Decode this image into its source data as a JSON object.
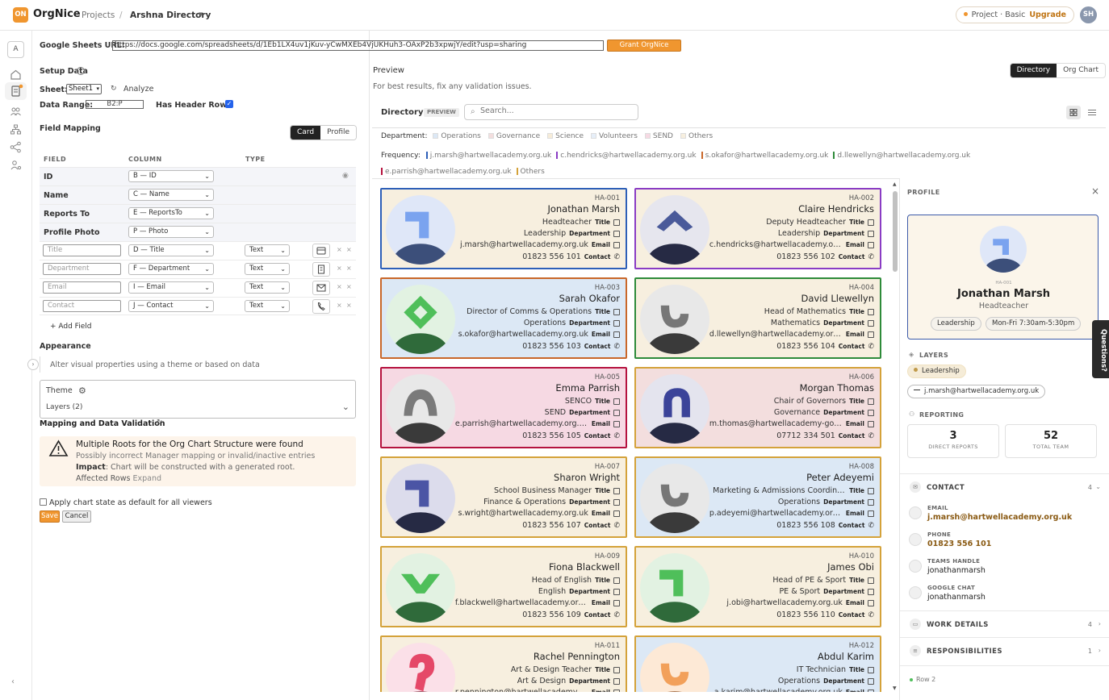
{
  "topbar": {
    "logo": "ON",
    "app_name": "OrgNice",
    "crumb_projects": "Projects",
    "crumb_sep": "/",
    "crumb_current": "Arshna Directory",
    "plan_label": "Project · Basic",
    "upgrade_label": "Upgrade",
    "user_initials": "SH"
  },
  "rail": {
    "workspace_initial": "A"
  },
  "setup": {
    "url_label": "Google Sheets URL:",
    "url_value": "https://docs.google.com/spreadsheets/d/1Eb1LX4uv1jKuv-yCwMXEb4VjUKHuh3-OAxP2b3xpwjY/edit?usp=sharing",
    "grant_label": "Grant OrgNice Access",
    "setup_title": "Setup Data",
    "sheet_label": "Sheet:",
    "sheet_value": "Sheet1",
    "analyze_label": "Analyze",
    "range_label": "Data Range:",
    "range_value": "B2:P",
    "header_row_label": "Has Header Row",
    "field_mapping_title": "Field Mapping",
    "card_tab": "Card",
    "profile_tab": "Profile",
    "col_field": "FIELD",
    "col_column": "COLUMN",
    "col_type": "TYPE",
    "required_fields": [
      {
        "name": "ID",
        "column": "B — ID"
      },
      {
        "name": "Name",
        "column": "C — Name"
      },
      {
        "name": "Reports To",
        "column": "E — ReportsTo"
      },
      {
        "name": "Profile Photo",
        "column": "P — Photo"
      }
    ],
    "custom_fields": [
      {
        "name": "Title",
        "column": "D — Title",
        "type": "Text",
        "icon": "id-card-icon"
      },
      {
        "name": "Department",
        "column": "F — Department",
        "type": "Text",
        "icon": "building-icon"
      },
      {
        "name": "Email",
        "column": "I — Email",
        "type": "Text",
        "icon": "envelope-icon"
      },
      {
        "name": "Contact",
        "column": "J — Contact",
        "type": "Text",
        "icon": "phone-icon"
      }
    ],
    "add_field": "+ Add Field",
    "appearance_title": "Appearance",
    "appearance_hint": "Alter visual properties using a theme or based on data",
    "theme_label": "Theme",
    "layers_label": "Layers (2)",
    "validation_title": "Mapping and Data Validation",
    "warn_title": "Multiple Roots for the Org Chart Structure were found",
    "warn_line1": "Possibly incorrect Manager mapping or invalid/inactive entries",
    "warn_impact_key": "Impact",
    "warn_impact": ": Chart will be constructed with a generated root.",
    "warn_rows": "Affected Rows",
    "warn_expand": "Expand",
    "default_state_label": "Apply chart state as default for all viewers",
    "save_label": "Save",
    "cancel_label": "Cancel"
  },
  "preview": {
    "title": "Preview",
    "hint": "For best results, fix any validation issues.",
    "view_directory": "Directory",
    "view_orgchart": "Org Chart",
    "dir_title": "Directory",
    "dir_badge": "PREVIEW",
    "search_placeholder": "Search...",
    "dept_label": "Department:",
    "departments": [
      {
        "name": "Operations",
        "color": "#dce8f5"
      },
      {
        "name": "Governance",
        "color": "#f3dede"
      },
      {
        "name": "Science",
        "color": "#f6ecd9"
      },
      {
        "name": "Volunteers",
        "color": "#e6eef8"
      },
      {
        "name": "SEND",
        "color": "#f6d9e3"
      },
      {
        "name": "Others",
        "color": "#f7efdf"
      }
    ],
    "freq_label": "Frequency:",
    "frequency": [
      {
        "name": "j.marsh@hartwellacademy.org.uk",
        "color": "#2d5fb8"
      },
      {
        "name": "c.hendricks@hartwellacademy.org.uk",
        "color": "#8a3cc4"
      },
      {
        "name": "s.okafor@hartwellacademy.org.uk",
        "color": "#c9672a"
      },
      {
        "name": "d.llewellyn@hartwellacademy.org.uk",
        "color": "#2e8b3a"
      },
      {
        "name": "e.parrish@hartwellacademy.org.uk",
        "color": "#b5123e"
      },
      {
        "name": "Others",
        "color": "#d4a23a"
      }
    ],
    "field_keys": {
      "title": "Title",
      "department": "Department",
      "email": "Email",
      "contact": "Contact"
    },
    "cards": [
      {
        "id": "HA-001",
        "name": "Jonathan Marsh",
        "title": "Headteacher",
        "dept": "Leadership",
        "email": "j.marsh@hartwellacademy.org.uk",
        "phone": "01823 556 101",
        "border": "#2d5fb8",
        "bg": "#f7efdf",
        "photo_bg": "#dfe7f8",
        "fg": "#7aa3ef",
        "body": "#3c4f7a",
        "glyph": "corner"
      },
      {
        "id": "HA-002",
        "name": "Claire Hendricks",
        "title": "Deputy Headteacher",
        "dept": "Leadership",
        "email": "c.hendricks@hartwellacademy.org.uk",
        "phone": "01823 556 102",
        "border": "#8a3cc4",
        "bg": "#f7efdf",
        "photo_bg": "#e6e6ee",
        "fg": "#4a5a9a",
        "body": "#262a44",
        "glyph": "chevron"
      },
      {
        "id": "HA-003",
        "name": "Sarah Okafor",
        "title": "Director of Comms & Operations",
        "dept": "Operations",
        "email": "s.okafor@hartwellacademy.org.uk",
        "phone": "01823 556 103",
        "border": "#c9672a",
        "bg": "#dce8f5",
        "photo_bg": "#e2f2e2",
        "fg": "#4fbf5a",
        "body": "#2f6a3a",
        "glyph": "diamond"
      },
      {
        "id": "HA-004",
        "name": "David Llewellyn",
        "title": "Head of Mathematics",
        "dept": "Mathematics",
        "email": "d.llewellyn@hartwellacademy.org.uk",
        "phone": "01823 556 104",
        "border": "#2e8b3a",
        "bg": "#f7efdf",
        "photo_bg": "#e8e8e8",
        "fg": "#777777",
        "body": "#3a3a3a",
        "glyph": "cup"
      },
      {
        "id": "HA-005",
        "name": "Emma Parrish",
        "title": "SENCO",
        "dept": "SEND",
        "email": "e.parrish@hartwellacademy.org.uk",
        "phone": "01823 556 105",
        "border": "#b5123e",
        "bg": "#f6d9e3",
        "photo_bg": "#e8e8e8",
        "fg": "#7a7a7a",
        "body": "#3a3a3a",
        "glyph": "arch"
      },
      {
        "id": "HA-006",
        "name": "Morgan Thomas",
        "title": "Chair of Governors",
        "dept": "Governance",
        "email": "m.thomas@hartwellacademy-governors.org.uk",
        "phone": "07712 334 501",
        "border": "#d4a23a",
        "bg": "#f3dede",
        "photo_bg": "#e4e4ee",
        "fg": "#3b4399",
        "body": "#262a44",
        "glyph": "archdown"
      },
      {
        "id": "HA-007",
        "name": "Sharon Wright",
        "title": "School Business Manager",
        "dept": "Finance & Operations",
        "email": "s.wright@hartwellacademy.org.uk",
        "phone": "01823 556 107",
        "border": "#d4a23a",
        "bg": "#f7efdf",
        "photo_bg": "#dcdcec",
        "fg": "#4b55a5",
        "body": "#262a44",
        "glyph": "corner"
      },
      {
        "id": "HA-008",
        "name": "Peter Adeyemi",
        "title": "Marketing & Admissions Coordinator",
        "dept": "Operations",
        "email": "p.adeyemi@hartwellacademy.org.uk",
        "phone": "01823 556 108",
        "border": "#d4a23a",
        "bg": "#dce8f5",
        "photo_bg": "#e8e8e8",
        "fg": "#777777",
        "body": "#3a3a3a",
        "glyph": "cup"
      },
      {
        "id": "HA-009",
        "name": "Fiona Blackwell",
        "title": "Head of English",
        "dept": "English",
        "email": "f.blackwell@hartwellacademy.org.uk",
        "phone": "01823 556 109",
        "border": "#d4a23a",
        "bg": "#f7efdf",
        "photo_bg": "#e2f2e2",
        "fg": "#4fbf5a",
        "body": "#2f6a3a",
        "glyph": "vee"
      },
      {
        "id": "HA-010",
        "name": "James Obi",
        "title": "Head of PE & Sport",
        "dept": "PE & Sport",
        "email": "j.obi@hartwellacademy.org.uk",
        "phone": "01823 556 110",
        "border": "#d4a23a",
        "bg": "#f7efdf",
        "photo_bg": "#e2f2e2",
        "fg": "#4fbf5a",
        "body": "#2f6a3a",
        "glyph": "corner"
      },
      {
        "id": "HA-011",
        "name": "Rachel Pennington",
        "title": "Art & Design Teacher",
        "dept": "Art & Design",
        "email": "r.pennington@hartwellacademy.org.uk",
        "phone": "",
        "border": "#d4a23a",
        "bg": "#f7efdf",
        "photo_bg": "#fbe0e8",
        "fg": "#e54868",
        "body": "#7a1e32",
        "glyph": "hook"
      },
      {
        "id": "HA-012",
        "name": "Abdul Karim",
        "title": "IT Technician",
        "dept": "Operations",
        "email": "a.karim@hartwellacademy.org.uk",
        "phone": "",
        "border": "#d4a23a",
        "bg": "#dce8f5",
        "photo_bg": "#fde9d6",
        "fg": "#f2a05a",
        "body": "#8a4a1a",
        "glyph": "cup"
      }
    ]
  },
  "profile": {
    "header": "PROFILE",
    "id": "HA-001",
    "name": "Jonathan Marsh",
    "title": "Headteacher",
    "pill_dept": "Leadership",
    "pill_hours": "Mon-Fri 7:30am-5:30pm",
    "layers_title": "LAYERS",
    "layer_dept": "Leadership",
    "layer_email": "j.marsh@hartwellacademy.org.uk",
    "reporting_title": "REPORTING",
    "direct_reports": "3",
    "direct_reports_label": "DIRECT REPORTS",
    "total_team": "52",
    "total_team_label": "TOTAL TEAM",
    "contact_title": "CONTACT",
    "contact_count": "4",
    "contacts": [
      {
        "key": "EMAIL",
        "value": "j.marsh@hartwellacademy.org.uk",
        "link": true
      },
      {
        "key": "PHONE",
        "value": "01823 556 101",
        "link": true
      },
      {
        "key": "TEAMS HANDLE",
        "value": "jonathanmarsh",
        "link": false
      },
      {
        "key": "GOOGLE CHAT",
        "value": "jonathanmarsh",
        "link": false
      }
    ],
    "work_title": "WORK DETAILS",
    "work_count": "4",
    "resp_title": "RESPONSIBILITIES",
    "resp_count": "1",
    "row_label": "Row 2"
  },
  "questions_tab": "Questions?"
}
